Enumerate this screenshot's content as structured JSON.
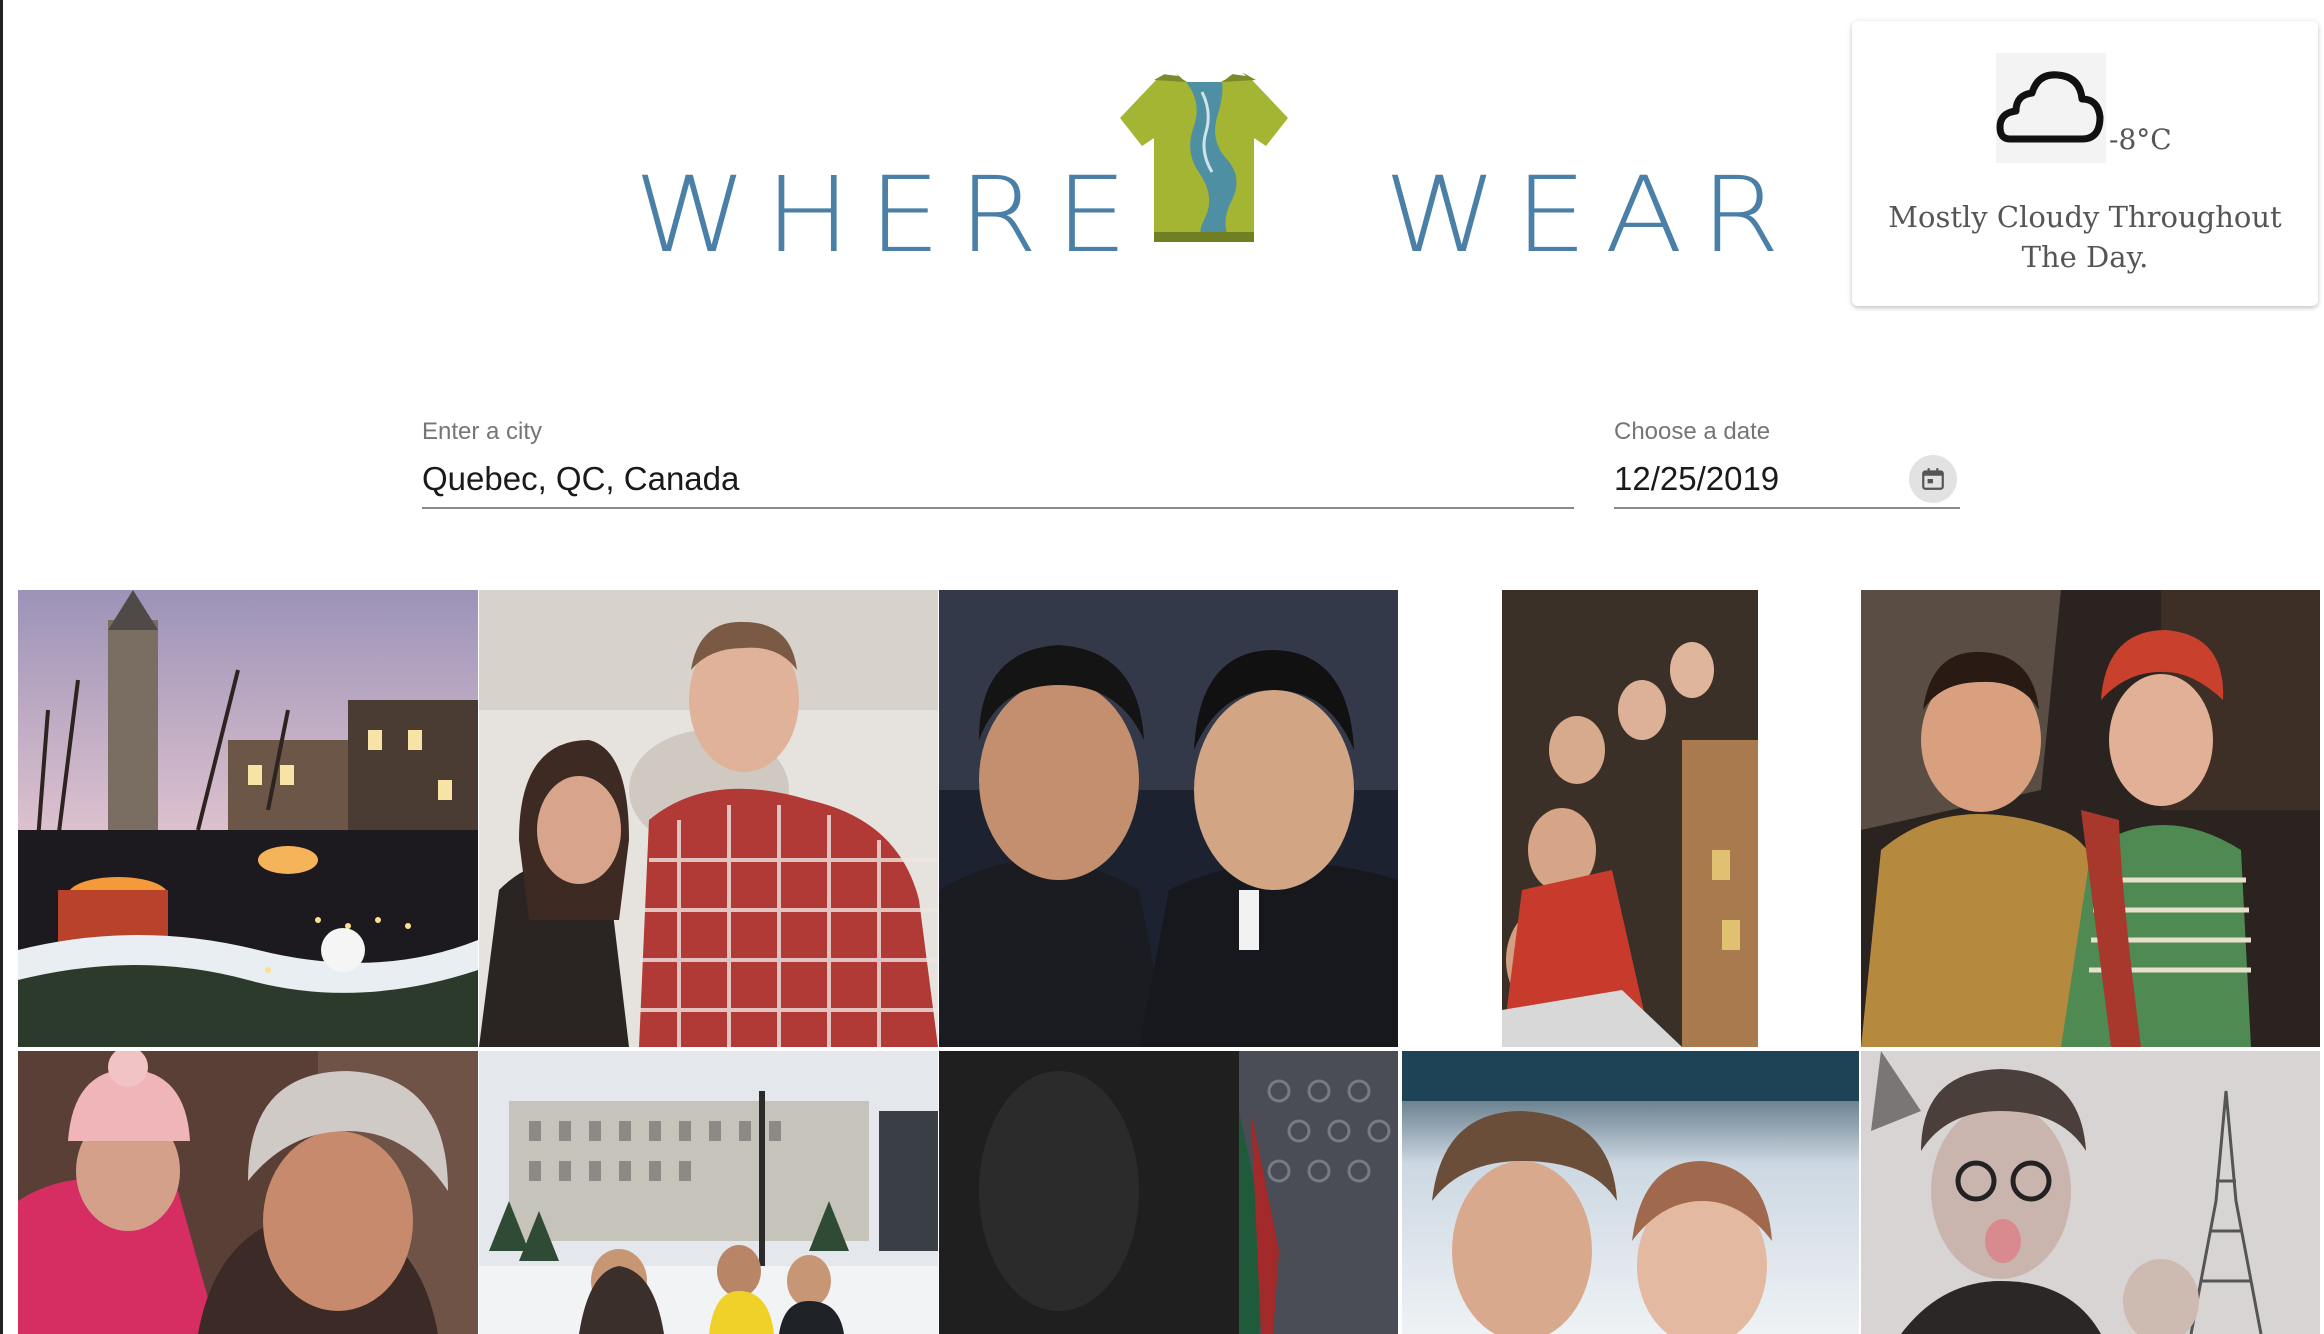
{
  "header": {
    "logo_left": "WHERE",
    "logo_right": "WEAR"
  },
  "weather": {
    "icon": "cloud-icon",
    "temperature": "-8°C",
    "summary": "Mostly Cloudy Throughout The Day."
  },
  "form": {
    "city": {
      "label": "Enter a city",
      "value": "Quebec, QC, Canada"
    },
    "date": {
      "label": "Choose a date",
      "value": "12/25/2019",
      "icon": "calendar-icon"
    }
  },
  "colors": {
    "logo_blue": "#4a7fa8",
    "shirt_green": "#a3b532",
    "river_blue": "#4f8fa3"
  },
  "photos": [
    "photo-winter-market",
    "photo-couple-plaid-shirt",
    "photo-two-men-selfie",
    "photo-bar-group-selfie",
    "photo-couple-red-hat",
    "photo-pink-hats-selfie",
    "photo-snow-building-group",
    "photo-dark-scarf",
    "photo-fur-hat-selfie",
    "photo-eiffel-tower-selfie"
  ]
}
